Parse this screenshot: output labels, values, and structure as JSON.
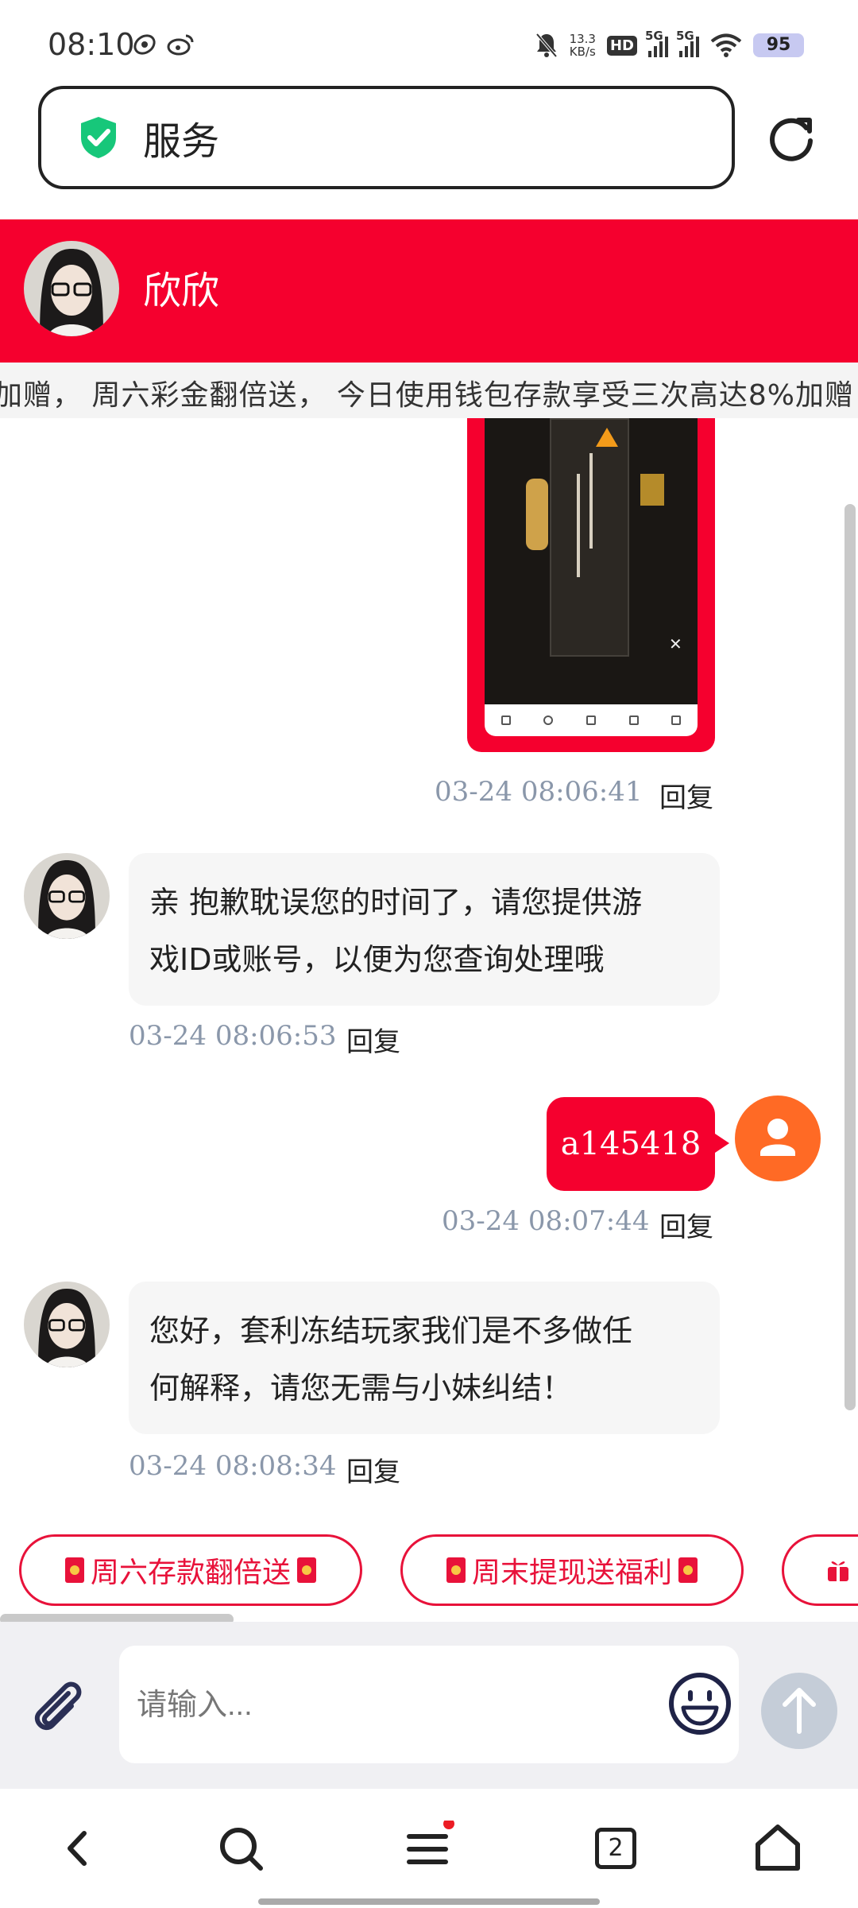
{
  "status_bar": {
    "time": "08:10",
    "net_speed_value": "13.3",
    "net_speed_unit": "KB/s",
    "hd": "HD",
    "signal_1": "5G",
    "signal_2": "5G",
    "battery": "95"
  },
  "url_bar": {
    "title": "服务",
    "icons": [
      "shield-check-icon",
      "refresh-icon"
    ]
  },
  "header": {
    "name": "欣欣"
  },
  "marquee": {
    "text": "加赠，  周六彩金翻倍送，  今日使用钱包存款享受三次高达8%加赠"
  },
  "messages": [
    {
      "type": "image",
      "direction": "outgoing",
      "time": "03-24 08:06:41",
      "reply": "回复"
    },
    {
      "type": "text",
      "direction": "incoming",
      "lines": [
        "亲 抱歉耽误您的时间了，请您提供游",
        "戏ID或账号，以便为您查询处理哦"
      ],
      "time": "03-24 08:06:53",
      "reply": "回复"
    },
    {
      "type": "text",
      "direction": "outgoing",
      "text": "a145418",
      "time": "03-24 08:07:44",
      "reply": "回复"
    },
    {
      "type": "text",
      "direction": "incoming",
      "lines": [
        "您好，套利冻结玩家我们是不多做任",
        "何解释，请您无需与小妹纠结！"
      ],
      "time": "03-24 08:08:34",
      "reply": "回复"
    }
  ],
  "quick_actions": [
    {
      "label": "周六存款翻倍送"
    },
    {
      "label": "周末提现送福利"
    }
  ],
  "input": {
    "placeholder": "请输入..."
  },
  "bottom_nav": {
    "tab_count": "2",
    "icons": [
      "back-icon",
      "search-icon",
      "menu-icon",
      "tabs-icon",
      "home-icon"
    ]
  },
  "colors": {
    "brand_red": "#f5002e",
    "user_avatar": "#ff6a25",
    "timestamp": "#8a97aa"
  }
}
